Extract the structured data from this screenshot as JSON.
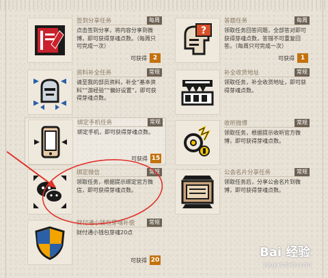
{
  "tasks": [
    {
      "title": "签到分享任务",
      "tag": "每周",
      "desc": "点击签到分享，将内容分享到微博，即可获得芽魂点数。（每周只可完成一次）",
      "reward_label": "可获得",
      "reward_value": "2",
      "icon": "book-pencil-icon"
    },
    {
      "title": "答题任务",
      "tag": "每周",
      "desc": "领取任务回答问题，全部答对即可获得芽魂点数，答错不可重复回答。（每周只可完成一次）",
      "reward_label": "可获得",
      "reward_value": "1",
      "icon": "quiz-head-icon"
    },
    {
      "title": "资料补全任务",
      "tag": "常规",
      "desc": "请至我的部员资料，补全“基本资料”“游经验”“偏好设置”，即可获得芽魂点数。",
      "reward_label": "",
      "reward_value": "",
      "icon": "knight-helmet-icon"
    },
    {
      "title": "补全收货地址",
      "tag": "常规",
      "desc": "领取任务，补全收货地址，即可获得芽魂点数。",
      "reward_label": "",
      "reward_value": "",
      "icon": "address-truck-icon"
    },
    {
      "title": "绑定手机任务",
      "tag": "常规",
      "desc": "绑定手机，即可获得芽魂点数。",
      "reward_label": "可获得",
      "reward_value": "15",
      "icon": "phone-icon"
    },
    {
      "title": "收听微博",
      "tag": "常规",
      "desc": "领取任务，根据提示收听官方微博，即可获得芽魂点数。",
      "reward_label": "",
      "reward_value": "",
      "icon": "weibo-listen-icon"
    },
    {
      "title": "绑定微信",
      "tag": "常规",
      "desc": "领取任务，根据提示绑定官方微信，即可获得芽魂点数。",
      "reward_label": "",
      "reward_value": "",
      "icon": "wechat-icon"
    },
    {
      "title": "公会名片分享任务",
      "tag": "常规",
      "desc": "领取任务后，分享公会名片到微博，即可获得芽魂点数。",
      "reward_label": "",
      "reward_value": "",
      "icon": "guild-card-icon"
    },
    {
      "title": "财付通小钱包芽魂补偿",
      "tag": "常规",
      "desc": "财付通小钱包芽魂20点",
      "reward_label": "可获得",
      "reward_value": "20",
      "icon": "shield-icon"
    }
  ],
  "watermark": {
    "brand": "Bai 经验",
    "url": "jingyan.baidu.com"
  },
  "colors": {
    "accent": "#c3720d",
    "tag_bg": "#6c6052",
    "annotation": "#e0302a"
  }
}
